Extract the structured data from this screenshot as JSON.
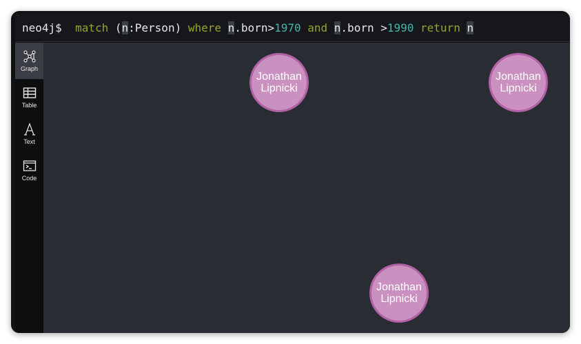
{
  "query": {
    "prompt": "neo4j$",
    "tokens": [
      {
        "text": "match",
        "kind": "kw"
      },
      {
        "text": " (",
        "kind": "plain"
      },
      {
        "text": "n",
        "kind": "var"
      },
      {
        "text": ":Person)",
        "kind": "plain"
      },
      {
        "text": " where",
        "kind": "kw"
      },
      {
        "text": " ",
        "kind": "plain"
      },
      {
        "text": "n",
        "kind": "var"
      },
      {
        "text": ".born>",
        "kind": "plain"
      },
      {
        "text": "1970",
        "kind": "num"
      },
      {
        "text": " and",
        "kind": "kw"
      },
      {
        "text": " ",
        "kind": "plain"
      },
      {
        "text": "n",
        "kind": "var"
      },
      {
        "text": ".born >",
        "kind": "plain"
      },
      {
        "text": "1990",
        "kind": "num"
      },
      {
        "text": " return",
        "kind": "kw"
      },
      {
        "text": " ",
        "kind": "plain"
      },
      {
        "text": "n",
        "kind": "var"
      }
    ]
  },
  "sidebar": {
    "items": [
      {
        "label": "Graph",
        "icon": "graph-icon",
        "active": true
      },
      {
        "label": "Table",
        "icon": "table-icon",
        "active": false
      },
      {
        "label": "Text",
        "icon": "text-icon",
        "active": false
      },
      {
        "label": "Code",
        "icon": "code-icon",
        "active": false
      }
    ]
  },
  "graph": {
    "nodes": [
      {
        "line1": "Jonathan",
        "line2": "Lipnicki",
        "label": "Person"
      },
      {
        "line1": "Jonathan",
        "line2": "Lipnicki",
        "label": "Person"
      },
      {
        "line1": "Jonathan",
        "line2": "Lipnicki",
        "label": "Person"
      }
    ],
    "colors": {
      "node_fill": "#c990c0",
      "node_border": "#b261a5",
      "canvas_bg": "#292c33"
    }
  }
}
